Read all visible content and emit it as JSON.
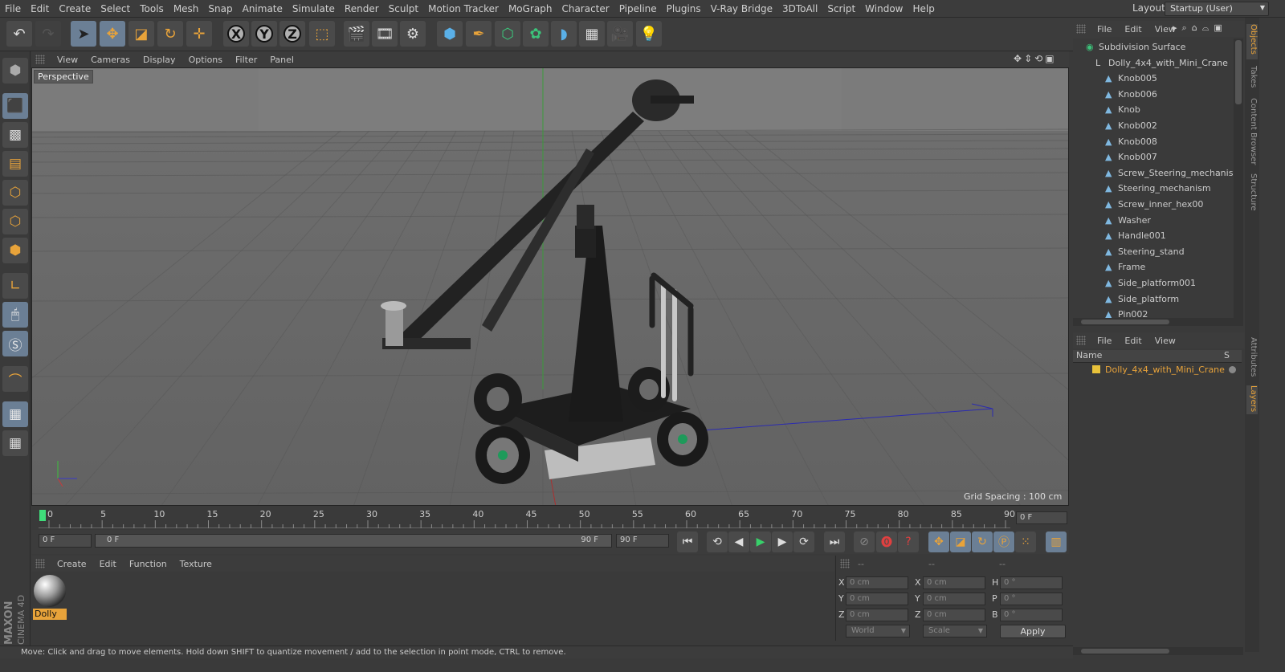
{
  "menu": [
    "File",
    "Edit",
    "Create",
    "Select",
    "Tools",
    "Mesh",
    "Snap",
    "Animate",
    "Simulate",
    "Render",
    "Sculpt",
    "Motion Tracker",
    "MoGraph",
    "Character",
    "Pipeline",
    "Plugins",
    "V-Ray Bridge",
    "3DToAll",
    "Script",
    "Window",
    "Help"
  ],
  "layout": {
    "label": "Layout:",
    "value": "Startup (User)"
  },
  "toolbar": {
    "axis_x": "X",
    "axis_y": "Y",
    "axis_z": "Z"
  },
  "viewport": {
    "menu": [
      "View",
      "Cameras",
      "Display",
      "Options",
      "Filter",
      "Panel"
    ],
    "label": "Perspective",
    "grid_spacing": "Grid Spacing : 100 cm"
  },
  "timeline": {
    "ticks": [
      "0",
      "5",
      "10",
      "15",
      "20",
      "25",
      "30",
      "35",
      "40",
      "45",
      "50",
      "55",
      "60",
      "65",
      "70",
      "75",
      "80",
      "85",
      "90"
    ],
    "current_frame_right": "0 F",
    "current_frame": "0 F",
    "range_start": "0 F",
    "range_end": "90 F",
    "max_frame": "90 F"
  },
  "material_manager": {
    "menu": [
      "Create",
      "Edit",
      "Function",
      "Texture"
    ],
    "materials": [
      {
        "name": "Dolly"
      }
    ]
  },
  "coordinates": {
    "col_headers": [
      "--",
      "--",
      "--"
    ],
    "rows": [
      {
        "l1": "X",
        "v1": "0 cm",
        "l2": "X",
        "v2": "0 cm",
        "l3": "H",
        "v3": "0 °"
      },
      {
        "l1": "Y",
        "v1": "0 cm",
        "l2": "Y",
        "v2": "0 cm",
        "l3": "P",
        "v3": "0 °"
      },
      {
        "l1": "Z",
        "v1": "0 cm",
        "l2": "Z",
        "v2": "0 cm",
        "l3": "B",
        "v3": "0 °"
      }
    ],
    "space": "World",
    "mode": "Scale",
    "apply_label": "Apply"
  },
  "status": "Move: Click and drag to move elements. Hold down SHIFT to quantize movement / add to the selection in point mode, CTRL to remove.",
  "object_manager": {
    "menu": [
      "File",
      "Edit",
      "View"
    ],
    "items": [
      {
        "name": "Subdivision Surface",
        "level": 0
      },
      {
        "name": "Dolly_4x4_with_Mini_Crane",
        "level": 1
      },
      {
        "name": "Knob005",
        "level": 2
      },
      {
        "name": "Knob006",
        "level": 2
      },
      {
        "name": "Knob",
        "level": 2
      },
      {
        "name": "Knob002",
        "level": 2
      },
      {
        "name": "Knob008",
        "level": 2
      },
      {
        "name": "Knob007",
        "level": 2
      },
      {
        "name": "Screw_Steering_mechanism",
        "level": 2
      },
      {
        "name": "Steering_mechanism",
        "level": 2
      },
      {
        "name": "Screw_inner_hex00",
        "level": 2
      },
      {
        "name": "Washer",
        "level": 2
      },
      {
        "name": "Handle001",
        "level": 2
      },
      {
        "name": "Steering_stand",
        "level": 2
      },
      {
        "name": "Frame",
        "level": 2
      },
      {
        "name": "Side_platform001",
        "level": 2
      },
      {
        "name": "Side_platform",
        "level": 2
      },
      {
        "name": "Pin002",
        "level": 2
      }
    ]
  },
  "layer_manager": {
    "menu": [
      "File",
      "Edit",
      "View"
    ],
    "col_name": "Name",
    "col_s": "S",
    "layers": [
      {
        "name": "Dolly_4x4_with_Mini_Crane",
        "color": "#e8c23a"
      }
    ]
  },
  "side_tabs": [
    "Objects",
    "Takes",
    "Content Browser",
    "Structure",
    "Attributes",
    "Layers"
  ]
}
